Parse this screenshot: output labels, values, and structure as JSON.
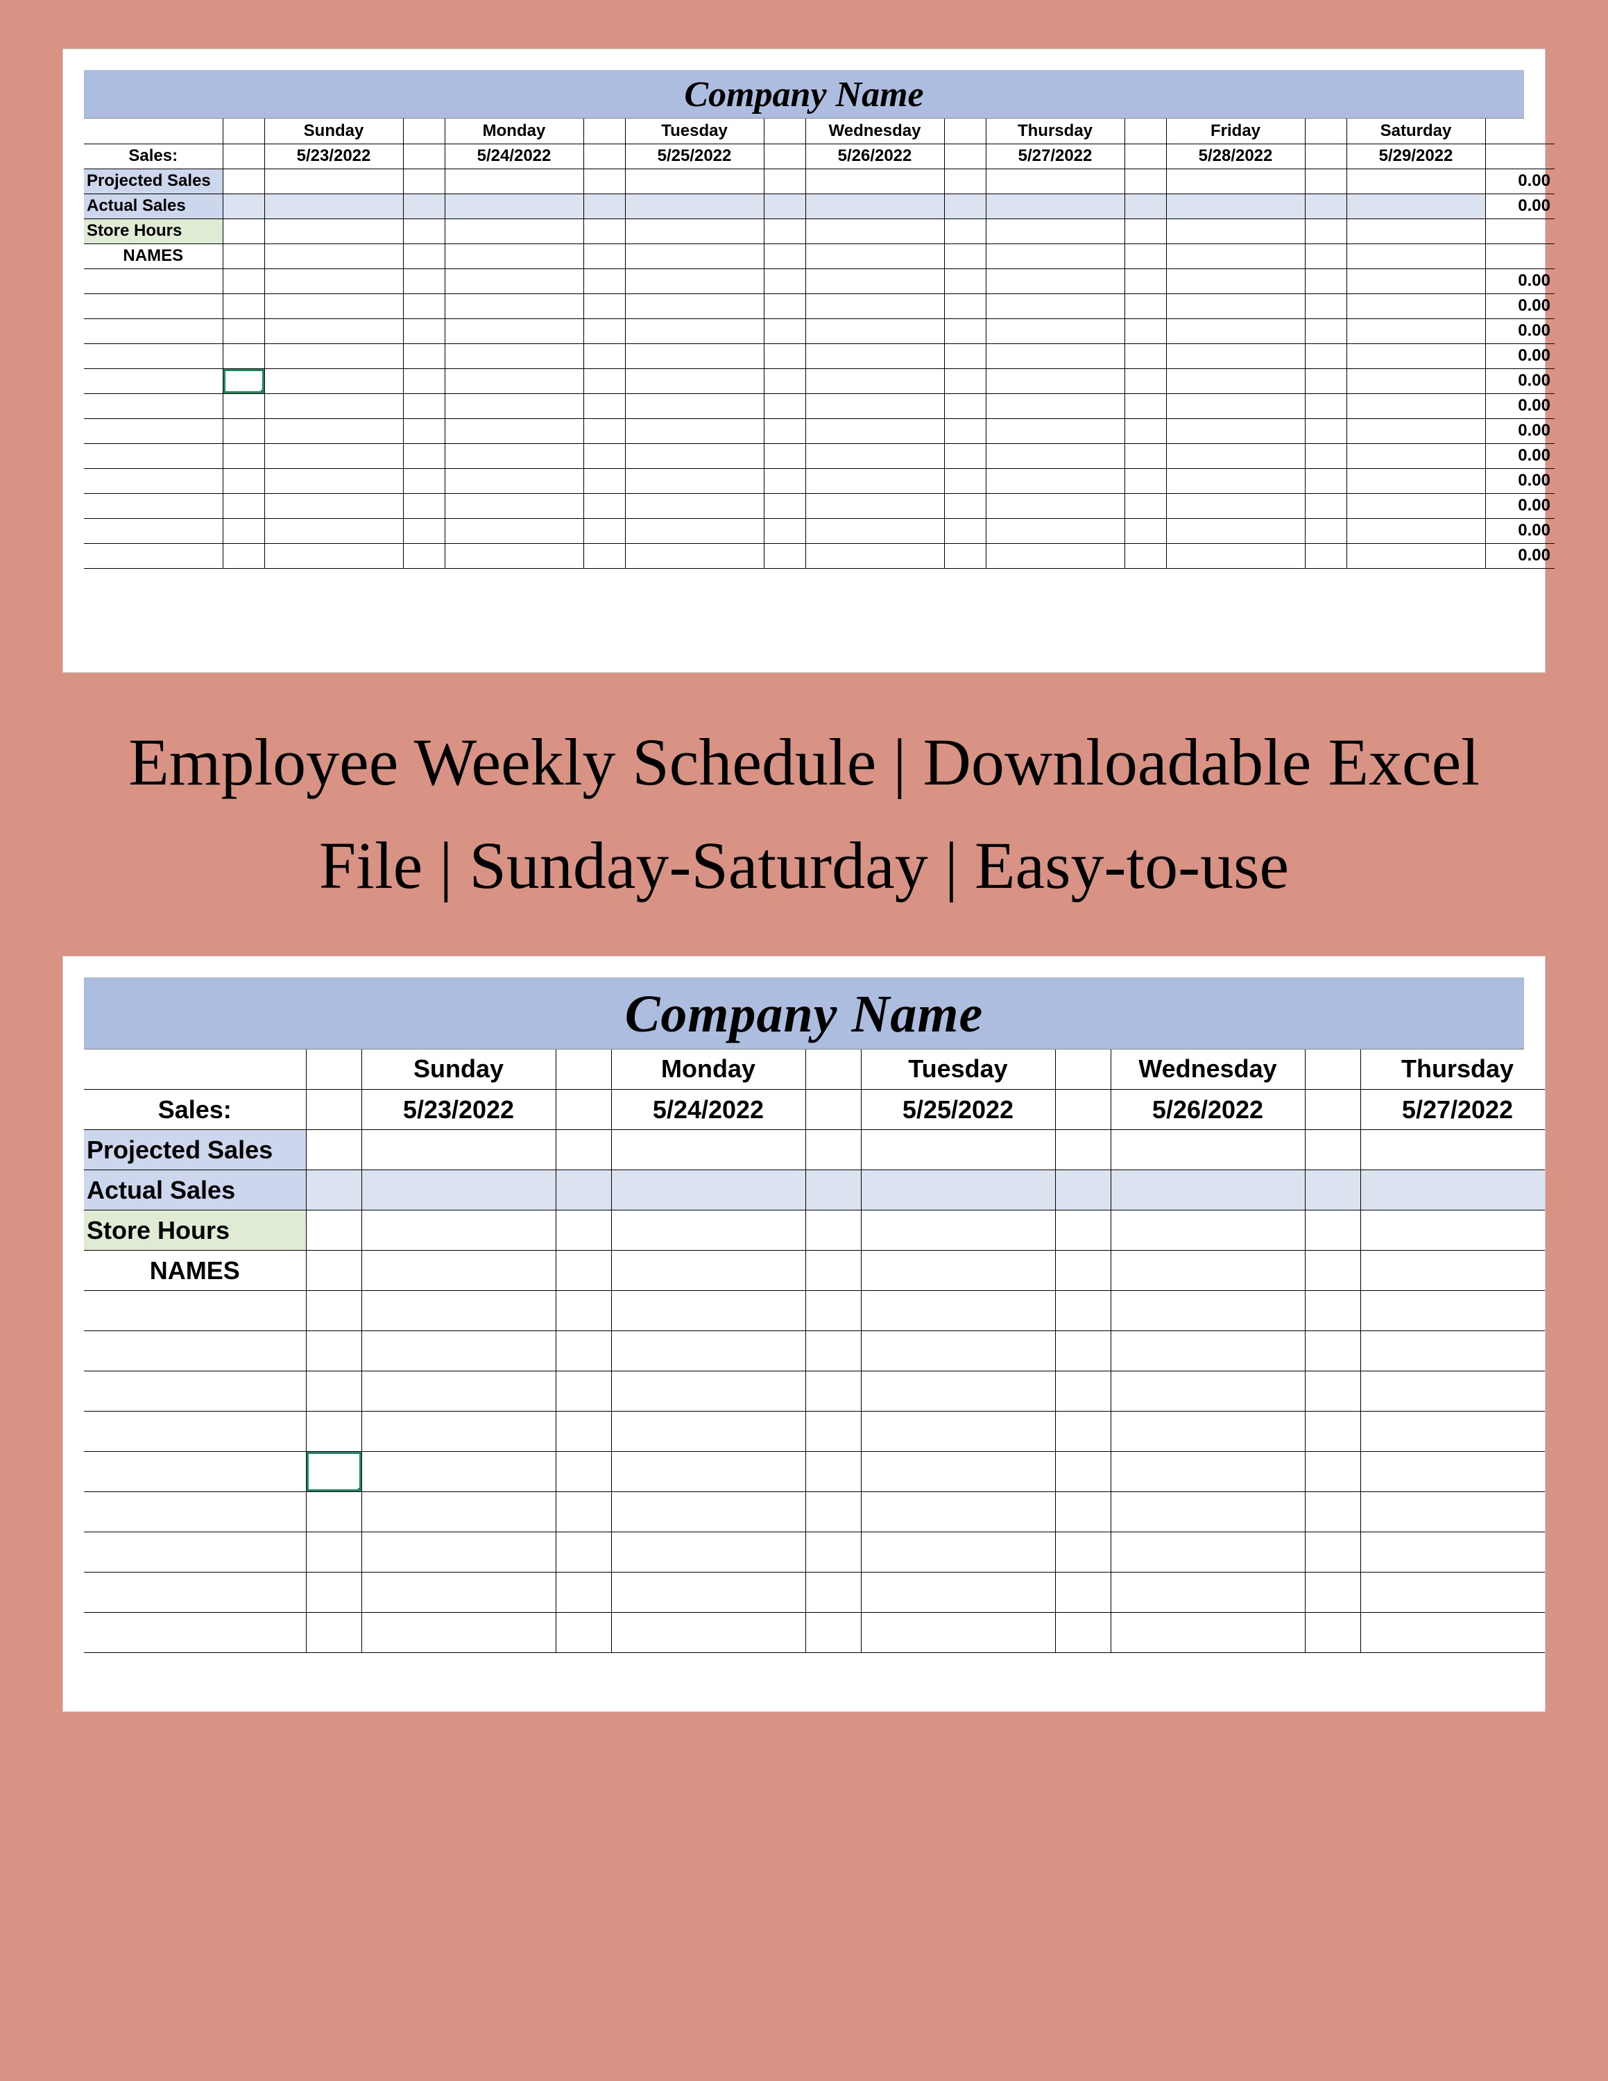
{
  "company_title": "Company Name",
  "promo": "Employee Weekly Schedule | Downloadable Excel File | Sunday-Saturday | Easy-to-use",
  "labels": {
    "sales": "Sales:",
    "projected": "Projected Sales",
    "actual": "Actual Sales",
    "storehours": "Store Hours",
    "names": "NAMES"
  },
  "days": [
    "Sunday",
    "Monday",
    "Tuesday",
    "Wednesday",
    "Thursday",
    "Friday",
    "Saturday"
  ],
  "dates": [
    "5/23/2022",
    "5/24/2022",
    "5/25/2022",
    "5/26/2022",
    "5/27/2022",
    "5/28/2022",
    "5/29/2022"
  ],
  "totals": {
    "projected": "0.00",
    "actual": "0.00",
    "rows": [
      "0.00",
      "0.00",
      "0.00",
      "0.00",
      "0.00",
      "0.00",
      "0.00",
      "0.00",
      "0.00",
      "0.00",
      "0.00",
      "0.00"
    ]
  },
  "bottom_visible_days": 5,
  "top_data_rows": 12,
  "bottom_data_rows": 9
}
